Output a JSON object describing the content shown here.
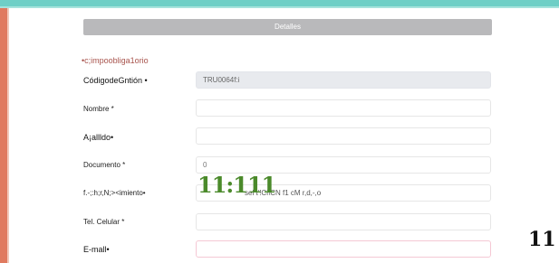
{
  "form": {
    "section_title": "Detalles",
    "required_note": "•c;impoobliga1orio",
    "fields": [
      {
        "label": "CódigodeGntión •",
        "value": "TRU0064f:i"
      },
      {
        "label": "Nombre *",
        "value": ""
      },
      {
        "label": "A¡allldo•",
        "value": ""
      },
      {
        "label": "Documento *",
        "value": "0"
      },
      {
        "label": "f.-;:h;r,N;><imiento•",
        "value": "sel t'!Ci\\CN f1 cM r,d,-,o"
      },
      {
        "label": "Tel. Celular *",
        "value": ""
      },
      {
        "label": "E-mall•",
        "value": ""
      }
    ]
  },
  "overlays": {
    "green_text": "11:111",
    "page_number": "11"
  },
  "colors": {
    "top_bar": "#6fcfc6",
    "left_stripe": "#e07a5f",
    "required_note": "#a8544d",
    "overlay_green": "#4b8a2b"
  }
}
